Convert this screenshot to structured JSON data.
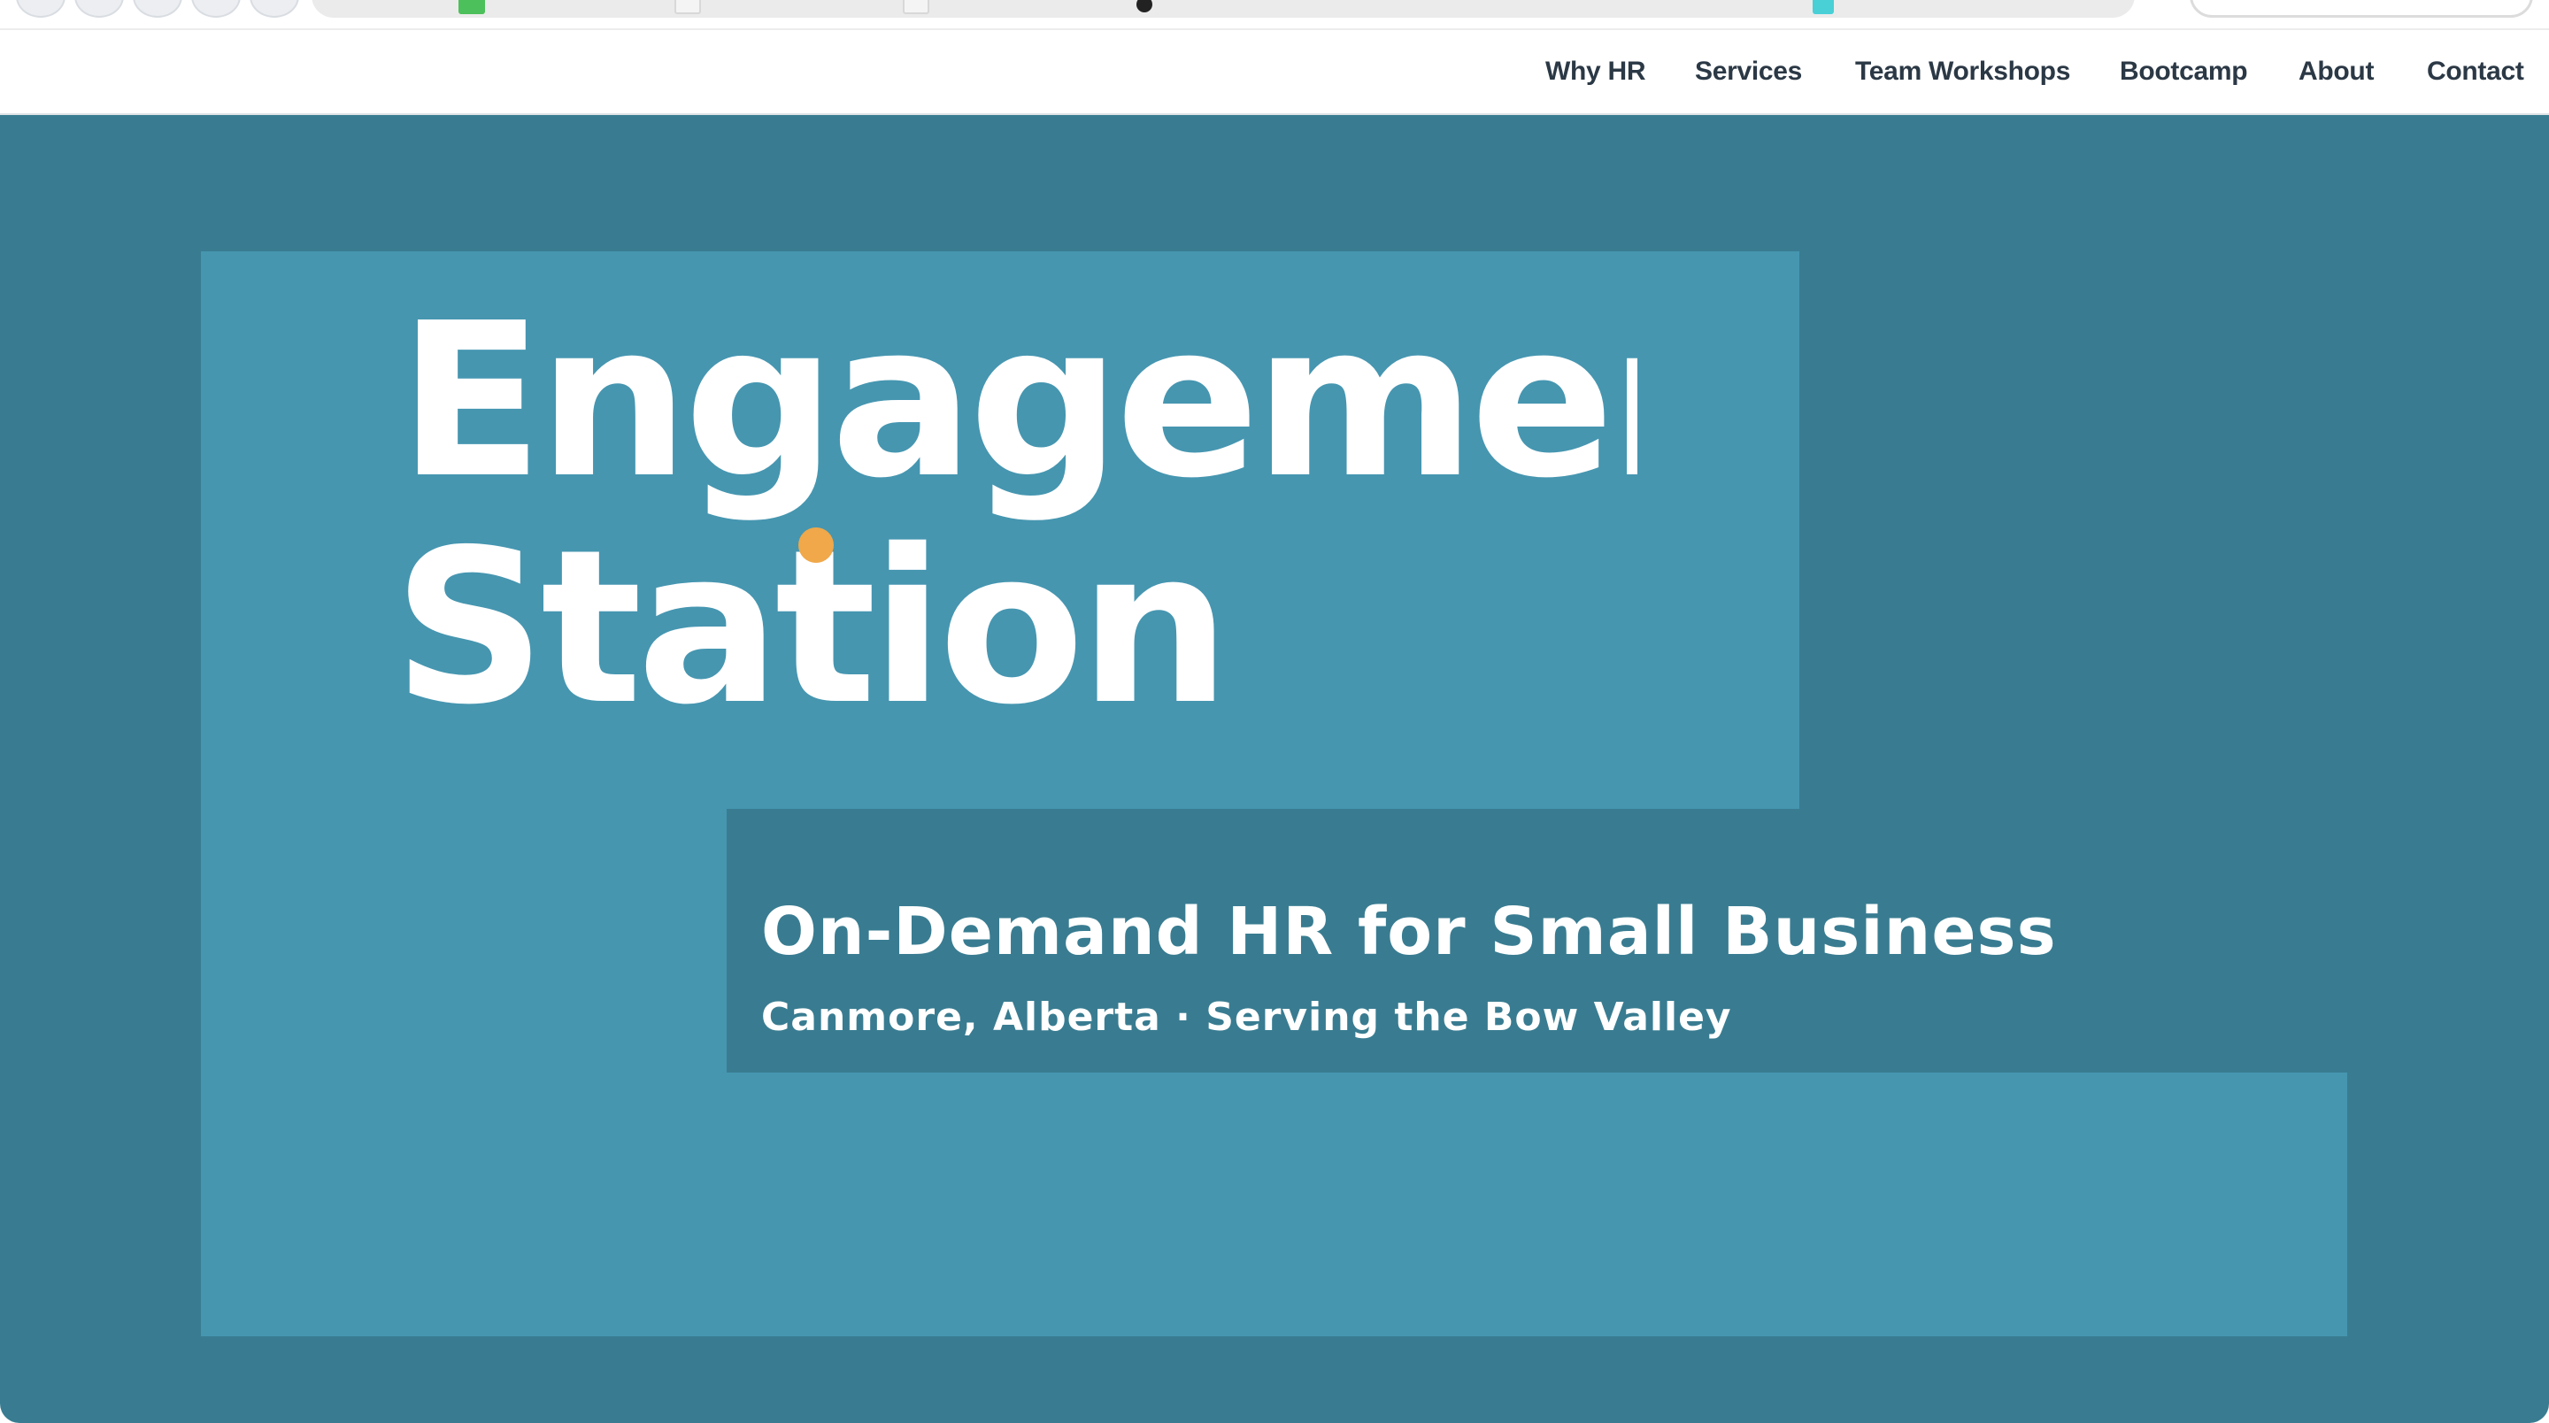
{
  "nav": {
    "items": [
      {
        "label": "Why HR"
      },
      {
        "label": "Services"
      },
      {
        "label": "Team Workshops"
      },
      {
        "label": "Bootcamp"
      },
      {
        "label": "About"
      },
      {
        "label": "Contact"
      }
    ]
  },
  "hero": {
    "logo": {
      "line1": "Engagement",
      "line2": "Station"
    },
    "tagline": "On-Demand HR for Small Business",
    "location": "Canmore, Alberta · Serving the Bow Valley"
  },
  "colors": {
    "hero_dark": "#397c91",
    "hero_light": "#4696b0",
    "accent_dot": "#f0a84a",
    "nav_text": "#2b3845"
  }
}
